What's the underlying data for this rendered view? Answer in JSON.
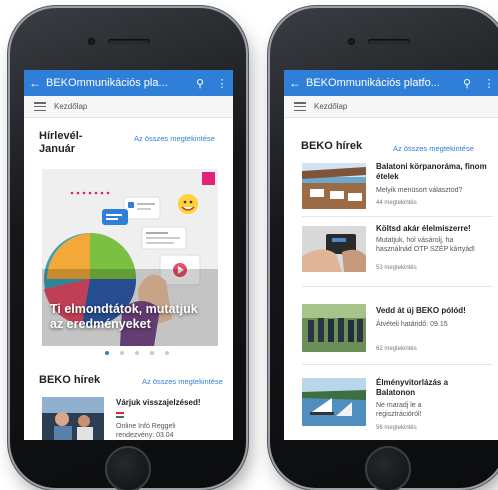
{
  "colors": {
    "accent": "#2f7fd8",
    "appbar": "#2f7fd8"
  },
  "left_phone": {
    "appbar": {
      "back_icon": "arrow-left-icon",
      "title": "BEKOmmunikációs pla...",
      "search_icon": "search-icon",
      "menu_icon": "more-vert-icon"
    },
    "breadcrumb": {
      "label": "Kezdőlap"
    },
    "newsletter": {
      "title": "Hírlevél-Január",
      "see_all": "Az összes megtekintése",
      "hero_caption": "Ti elmondtátok, mutatjuk az eredményeket",
      "dots_count": 5,
      "active_dot": 1
    },
    "news": {
      "title": "BEKO hírek",
      "see_all": "Az összes megtekintése",
      "items": [
        {
          "title": "Várjuk visszajelzésed!",
          "subtitle": "Online Infó Reggeli rendezvény: 03.04"
        }
      ]
    }
  },
  "right_phone": {
    "appbar": {
      "back_icon": "arrow-left-icon",
      "title": "BEKOmmunikációs platfo...",
      "search_icon": "search-icon",
      "menu_icon": "more-vert-icon"
    },
    "breadcrumb": {
      "label": "Kezdőlap"
    },
    "news": {
      "title": "BEKO hírek",
      "see_all": "Az összes megtekintése",
      "items": [
        {
          "title": "Balatoni körpanoráma, finom ételek",
          "subtitle": "Melyik menüsort választod?",
          "views": "44 megtekintés"
        },
        {
          "title": "Költsd akár élelmiszerre!",
          "subtitle": "Mutatjuk, hol vásárolj, ha használnád OTP SZÉP kártyád!",
          "views": "53 megtekintés"
        },
        {
          "title": "Vedd át új BEKO pólód!",
          "subtitle": "Átvételi határidő: 09.15",
          "views": "62 megtekintés"
        },
        {
          "title": "Élményvitorlázás a Balatonon",
          "subtitle": "Ne maradj le a regisztrációról!",
          "views": "56 megtekintés"
        }
      ]
    }
  }
}
